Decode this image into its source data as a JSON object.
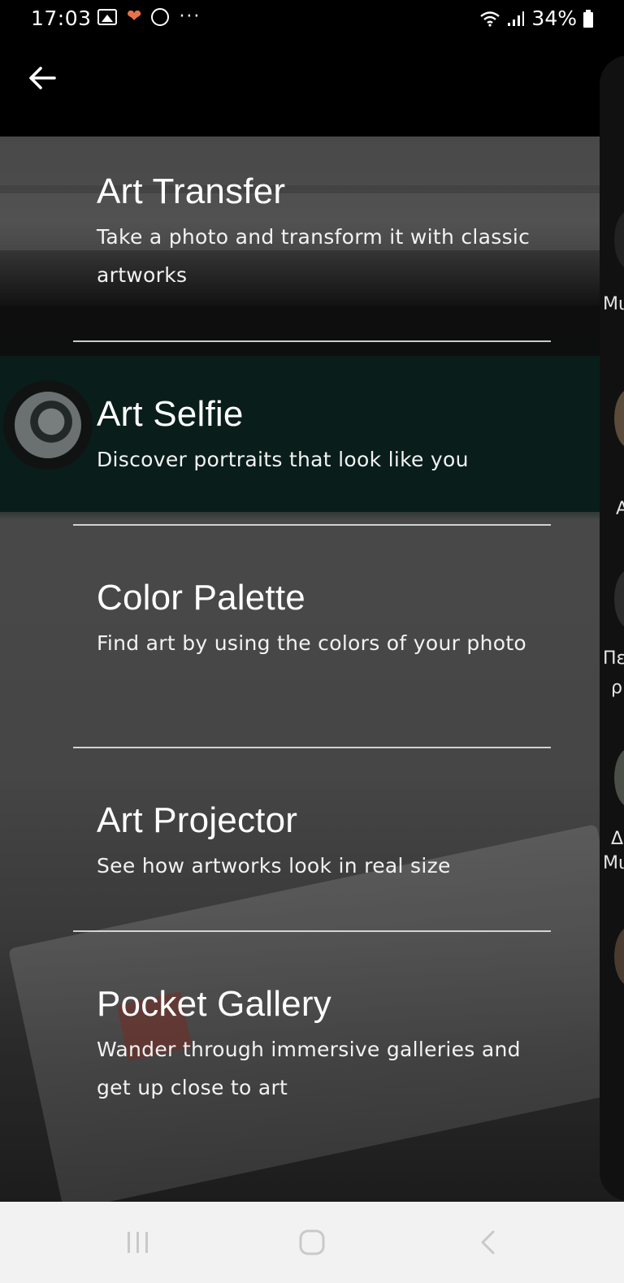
{
  "status_bar": {
    "time": "17:03",
    "battery": "34%",
    "more": "···"
  },
  "app_bar": {
    "back_icon": "arrow-back-icon"
  },
  "menu": {
    "items": [
      {
        "title": "Art Transfer",
        "description": "Take a photo and transform it with classic artworks"
      },
      {
        "title": "Art Selfie",
        "description": "Discover portraits that look like you"
      },
      {
        "title": "Color Palette",
        "description": "Find art by using the colors of your photo"
      },
      {
        "title": "Art Projector",
        "description": "See how artworks look in real size"
      },
      {
        "title": "Pocket Gallery",
        "description": "Wander through immersive galleries and get up close to art"
      }
    ]
  },
  "side_panel": {
    "labels": [
      "Μι",
      "Α",
      "Πε",
      "ρ",
      "Δ",
      "Μι"
    ]
  },
  "nav_bar": {
    "recents_icon": "recents-icon",
    "home_icon": "home-icon",
    "back_icon": "back-icon"
  },
  "colors": {
    "overlay_text": "#ffffff",
    "divider": "#ebebeb",
    "nav_bg": "#f2f2f2"
  }
}
